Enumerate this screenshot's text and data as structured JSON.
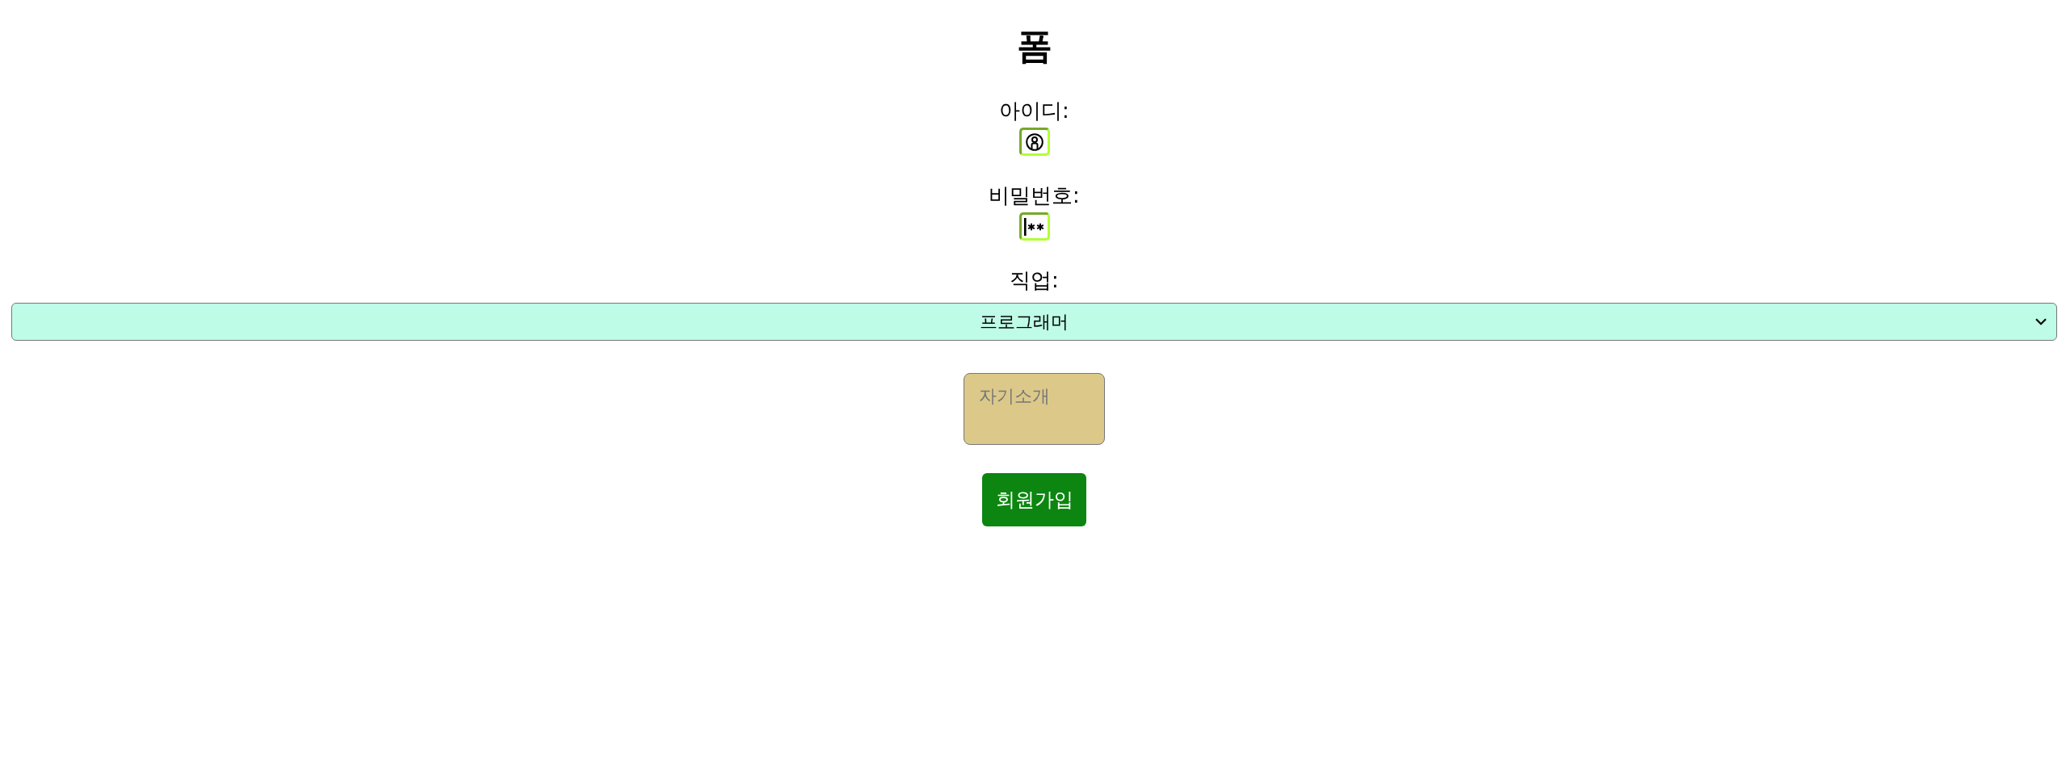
{
  "title": "폼",
  "fields": [
    {
      "kind": "text",
      "label": "아이디:"
    },
    {
      "kind": "password",
      "label": "비밀번호:"
    }
  ],
  "job": {
    "label": "직업:",
    "value": "프로그래머"
  },
  "intro": {
    "placeholder": "자기소개"
  },
  "submit": {
    "label": "회원가입"
  }
}
